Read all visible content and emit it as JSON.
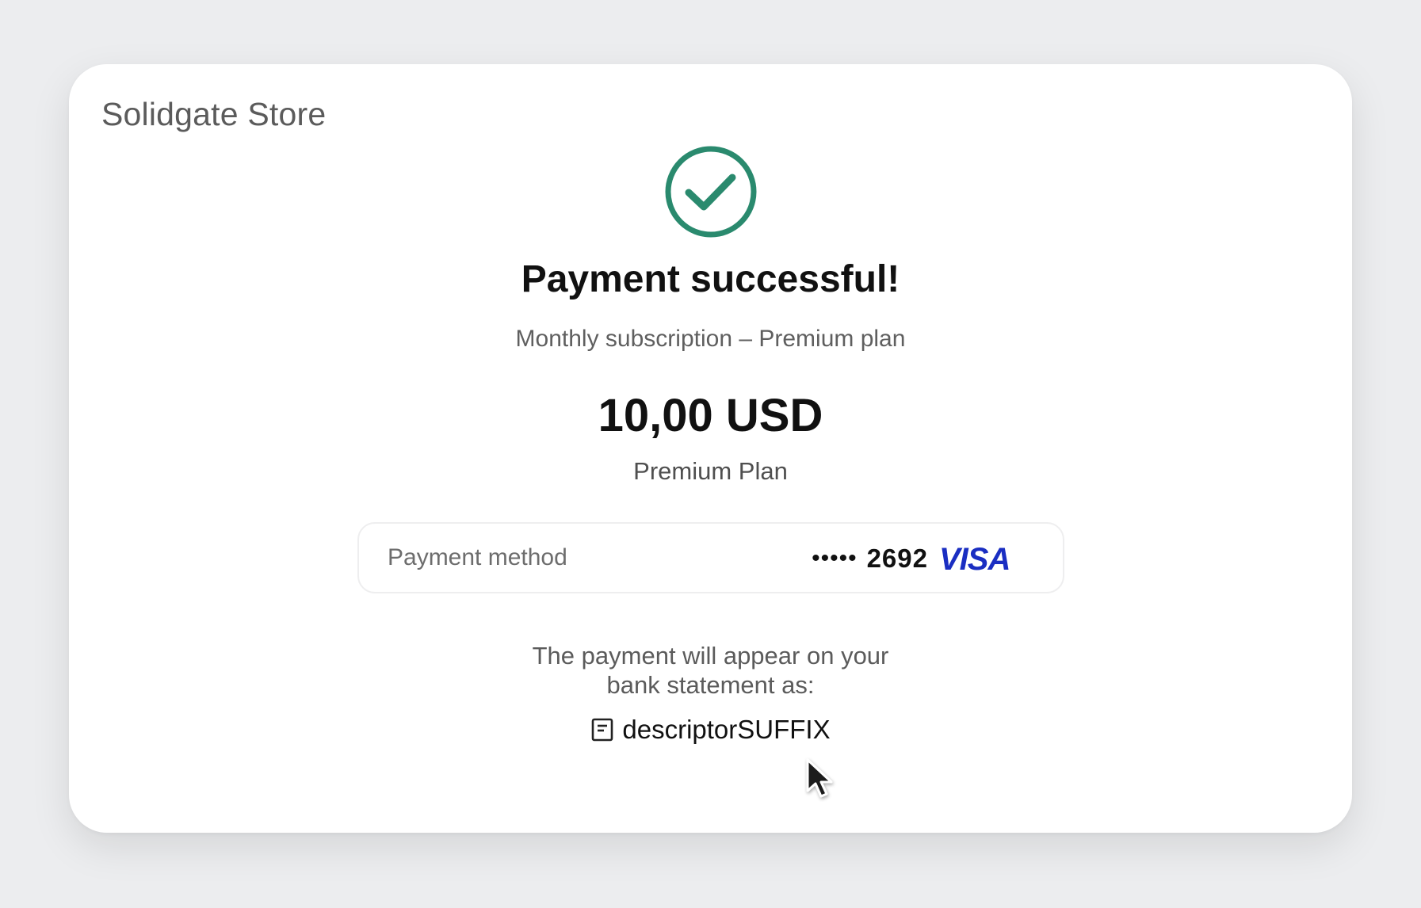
{
  "store": {
    "name": "Solidgate Store"
  },
  "status": {
    "icon": "check-circle-icon",
    "title": "Payment successful!",
    "subtitle": "Monthly subscription – Premium plan"
  },
  "order": {
    "amount": "10,00 USD",
    "product": "Premium Plan"
  },
  "payment_method": {
    "label": "Payment method",
    "mask": "••••• ",
    "last4": "2692",
    "brand": "VISA",
    "brand_icon": "visa-logo"
  },
  "statement": {
    "line1": "The payment will appear on your",
    "line2": "bank statement as:",
    "icon": "receipt-icon",
    "descriptor": "descriptorSUFFIX"
  },
  "colors": {
    "success": "#2a8a6e",
    "visa": "#1a2ec2",
    "background": "#ecedef",
    "card": "#ffffff"
  }
}
